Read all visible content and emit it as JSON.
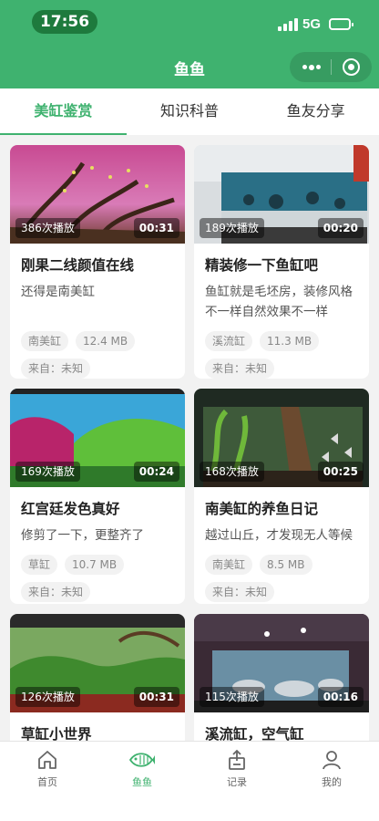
{
  "status": {
    "time": "17:56",
    "network": "5G"
  },
  "header": {
    "title": "鱼鱼"
  },
  "tabs": [
    {
      "label": "美缸鉴赏",
      "active": true
    },
    {
      "label": "知识科普",
      "active": false
    },
    {
      "label": "鱼友分享",
      "active": false
    }
  ],
  "cards": [
    {
      "plays": "386次播放",
      "duration": "00:31",
      "title": "刚果二线颜值在线",
      "desc": "还得是南美缸",
      "tag": "南美缸",
      "size": "12.4 MB",
      "source": "来自：未知"
    },
    {
      "plays": "189次播放",
      "duration": "00:20",
      "title": "精装修一下鱼缸吧",
      "desc": "鱼缸就是毛坯房，装修风格不一样自然效果不一样",
      "tag": "溪流缸",
      "size": "11.3 MB",
      "source": "来自：未知"
    },
    {
      "plays": "169次播放",
      "duration": "00:24",
      "title": "红宫廷发色真好",
      "desc": "修剪了一下，更整齐了",
      "tag": "草缸",
      "size": "10.7 MB",
      "source": "来自：未知"
    },
    {
      "plays": "168次播放",
      "duration": "00:25",
      "title": "南美缸的养鱼日记",
      "desc": "越过山丘，才发现无人等候",
      "tag": "南美缸",
      "size": "8.5 MB",
      "source": "来自：未知"
    },
    {
      "plays": "126次播放",
      "duration": "00:31",
      "title": "草缸小世界",
      "desc": "",
      "tag": "",
      "size": "",
      "source": ""
    },
    {
      "plays": "115次播放",
      "duration": "00:16",
      "title": "溪流缸，空气缸",
      "desc": "",
      "tag": "",
      "size": "",
      "source": ""
    }
  ],
  "bottom_nav": [
    {
      "label": "首页",
      "icon": "home-icon",
      "active": false
    },
    {
      "label": "鱼鱼",
      "icon": "fish-icon",
      "active": true
    },
    {
      "label": "记录",
      "icon": "upload-icon",
      "active": false
    },
    {
      "label": "我的",
      "icon": "user-icon",
      "active": false
    }
  ],
  "colors": {
    "brand": "#3fb26f",
    "brand_dark": "#1e7a3d"
  }
}
